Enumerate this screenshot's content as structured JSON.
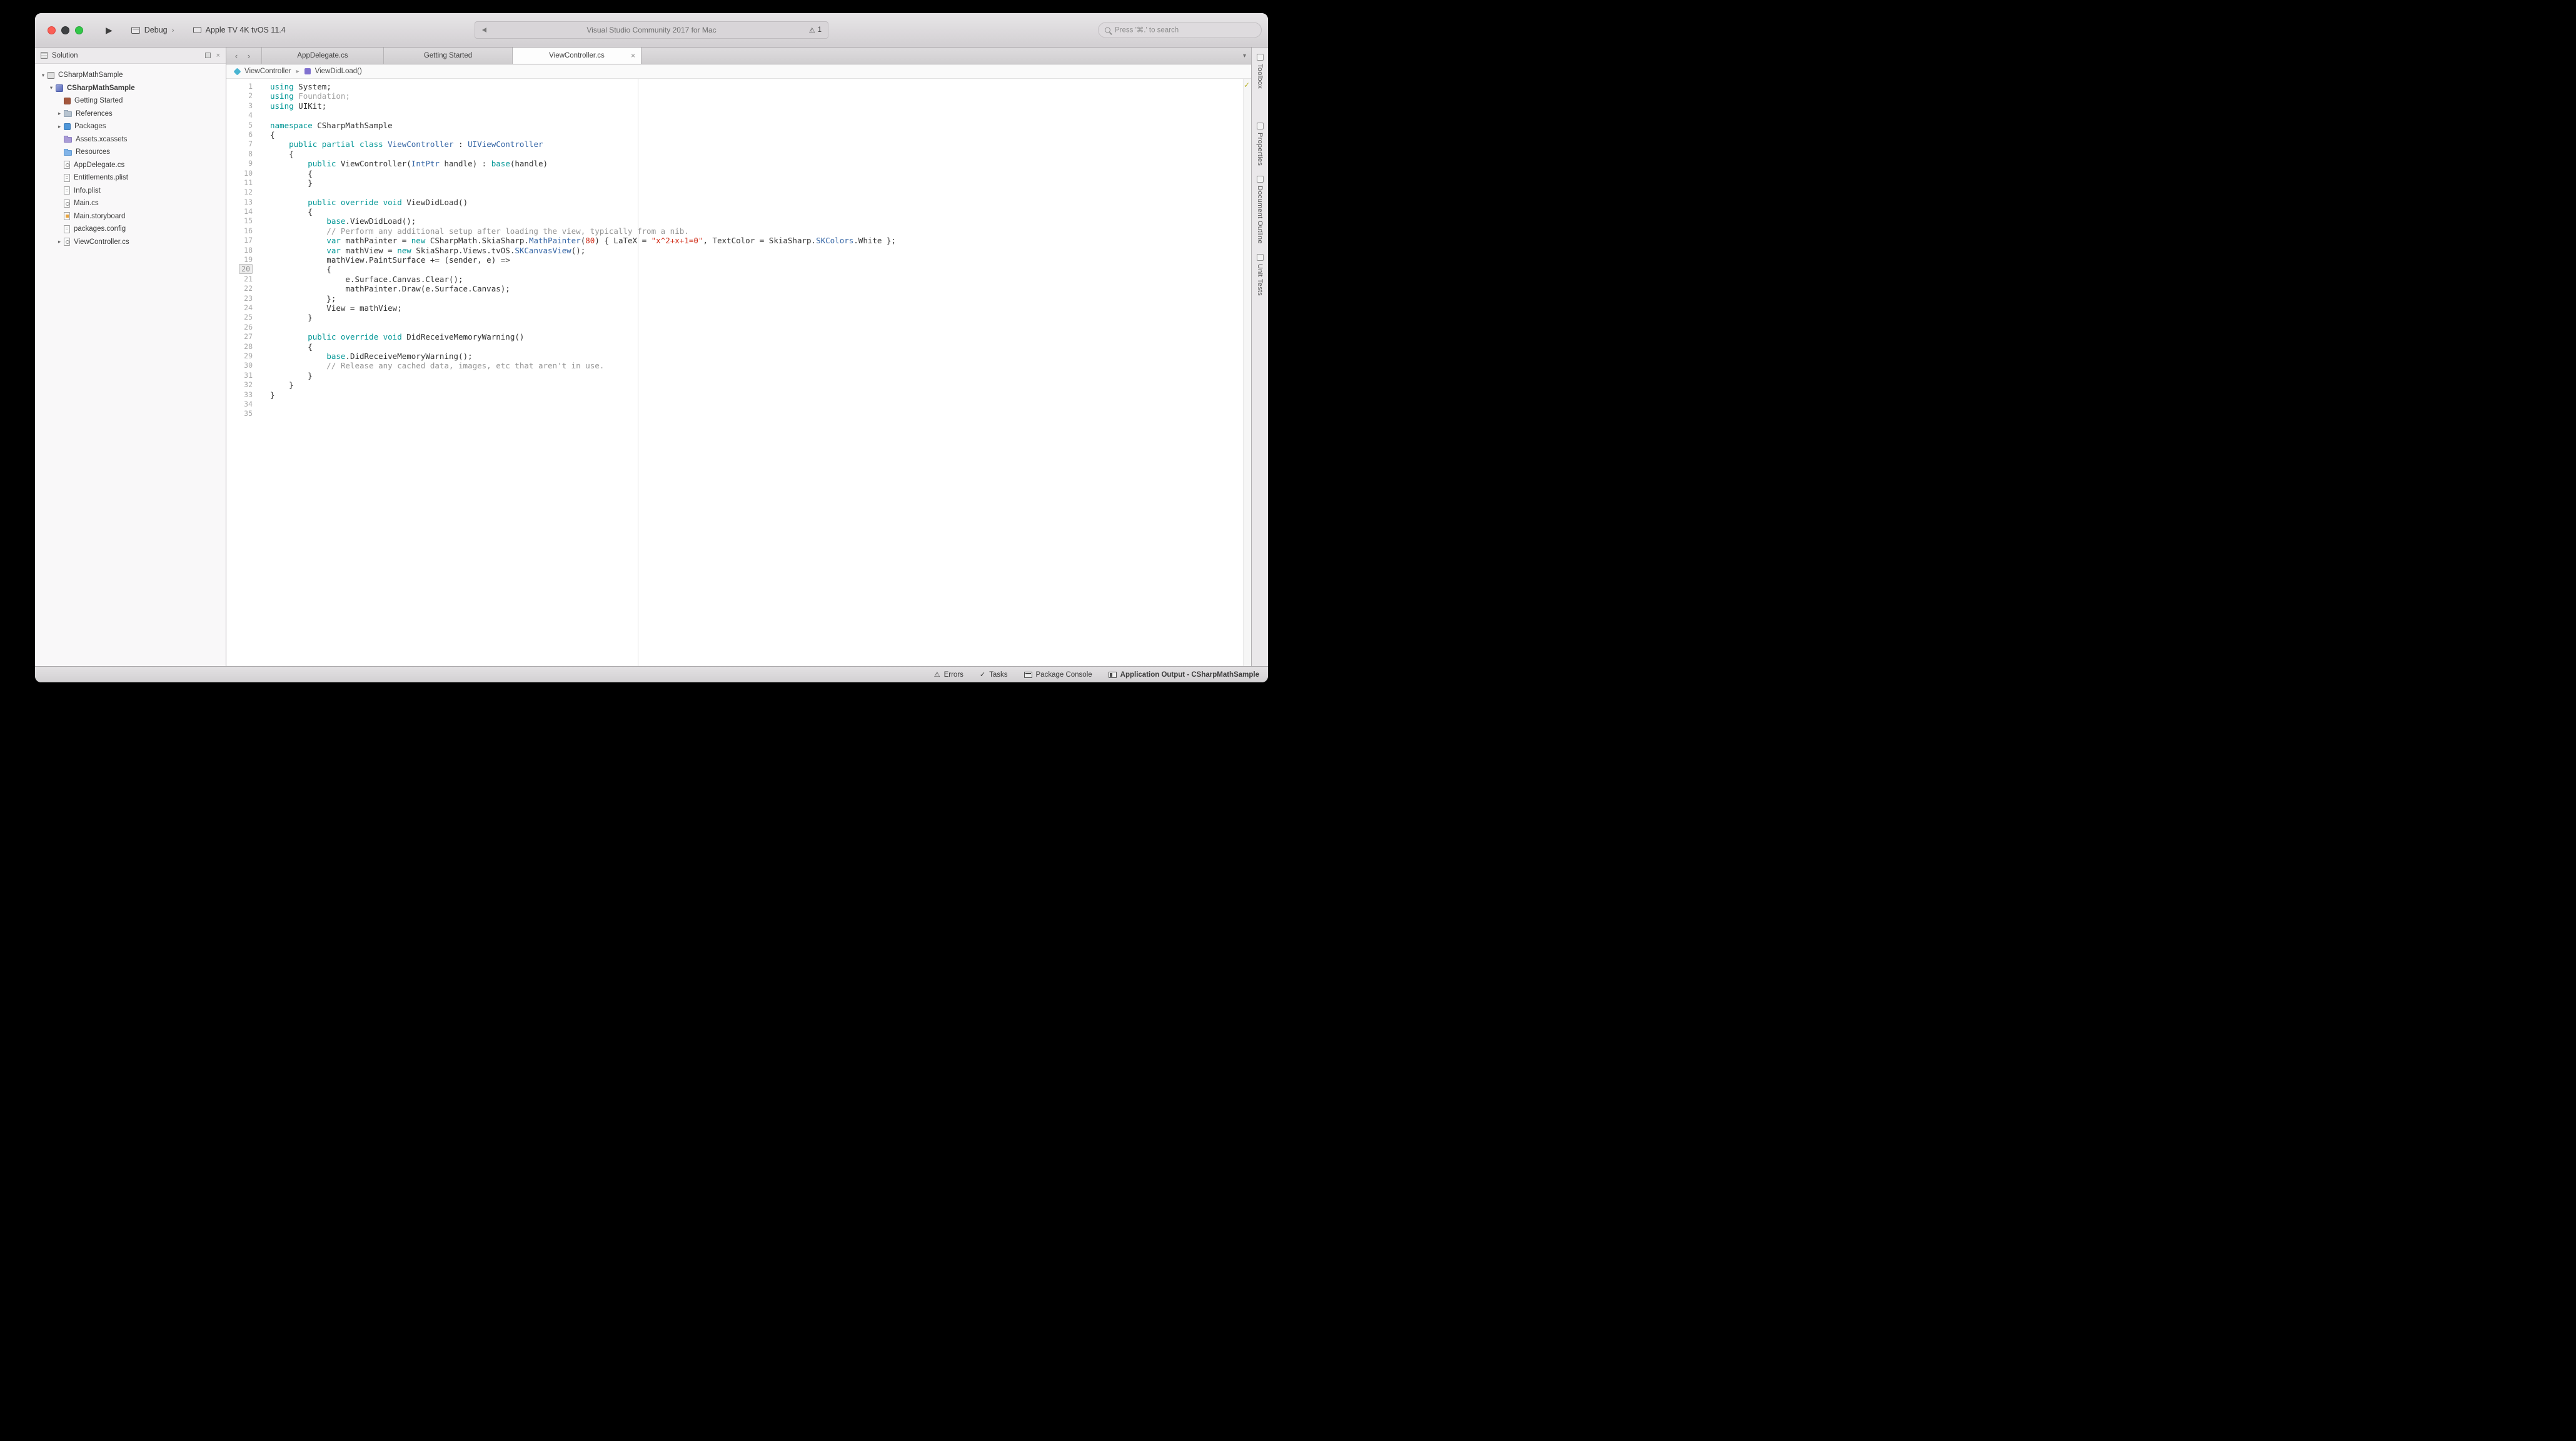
{
  "icons": {
    "run-icon": "▶",
    "back-icon": "‹",
    "forward-icon": "›",
    "overflow-icon": "▾",
    "close-icon": "×",
    "pad-close-icon": "×",
    "disclosure-open-icon": "▾",
    "disclosure-closed-icon": "▸",
    "crumb-separator-icon": "▸",
    "warning-icon": "⚠",
    "errors-icon": "⚠",
    "tasks-icon": "✓",
    "status-check-icon": "✓"
  },
  "colors": {
    "keyword": "#009695",
    "type": "#3364a4",
    "string": "#d12f1b",
    "comment": "#949494",
    "accent_titlebar": "#d8d5d8"
  },
  "window": {
    "toolbar": {
      "debug_label": "Debug",
      "debug_chevron": "›",
      "device_label": "Apple TV 4K tvOS 11.4",
      "status_text": "Visual Studio Community 2017 for Mac",
      "warning_count": "1",
      "search_placeholder": "Press '⌘.' to search"
    }
  },
  "sidebar": {
    "header": "Solution",
    "tree": [
      {
        "label": "CSharpMathSample",
        "level": 0,
        "disclosure": "open",
        "icon": "solution-icon",
        "bold": false
      },
      {
        "label": "CSharpMathSample",
        "level": 1,
        "disclosure": "open",
        "icon": "project-icon",
        "bold": true
      },
      {
        "label": "Getting Started",
        "level": 2,
        "disclosure": "none",
        "icon": "getting-started-icon",
        "bold": false
      },
      {
        "label": "References",
        "level": 2,
        "disclosure": "closed",
        "icon": "references-icon",
        "bold": false
      },
      {
        "label": "Packages",
        "level": 2,
        "disclosure": "closed",
        "icon": "packages-icon",
        "bold": false
      },
      {
        "label": "Assets.xcassets",
        "level": 2,
        "disclosure": "none",
        "icon": "asset-catalog-icon",
        "bold": false
      },
      {
        "label": "Resources",
        "level": 2,
        "disclosure": "none",
        "icon": "folder-icon",
        "bold": false
      },
      {
        "label": "AppDelegate.cs",
        "level": 2,
        "disclosure": "none",
        "icon": "csharp-file-icon",
        "bold": false
      },
      {
        "label": "Entitlements.plist",
        "level": 2,
        "disclosure": "none",
        "icon": "plist-file-icon",
        "bold": false
      },
      {
        "label": "Info.plist",
        "level": 2,
        "disclosure": "none",
        "icon": "plist-file-icon",
        "bold": false
      },
      {
        "label": "Main.cs",
        "level": 2,
        "disclosure": "none",
        "icon": "csharp-file-icon",
        "bold": false
      },
      {
        "label": "Main.storyboard",
        "level": 2,
        "disclosure": "none",
        "icon": "storyboard-file-icon",
        "bold": false
      },
      {
        "label": "packages.config",
        "level": 2,
        "disclosure": "none",
        "icon": "config-file-icon",
        "bold": false
      },
      {
        "label": "ViewController.cs",
        "level": 2,
        "disclosure": "closed",
        "icon": "csharp-file-icon",
        "bold": false
      }
    ]
  },
  "tabs": {
    "items": [
      {
        "label": "AppDelegate.cs",
        "active": false,
        "closable": false
      },
      {
        "label": "Getting Started",
        "active": false,
        "closable": false
      },
      {
        "label": "ViewController.cs",
        "active": true,
        "closable": true
      }
    ]
  },
  "breadcrumb": {
    "items": [
      {
        "icon": "class-icon",
        "label": "ViewController"
      },
      {
        "icon": "method-icon",
        "label": "ViewDidLoad()"
      }
    ]
  },
  "editor": {
    "current_line": 20,
    "lines": [
      {
        "n": 1,
        "t": [
          [
            "kw",
            "using"
          ],
          [
            "pl",
            " System;"
          ]
        ]
      },
      {
        "n": 2,
        "t": [
          [
            "kw",
            "using"
          ],
          [
            "gr",
            " Foundation;"
          ]
        ]
      },
      {
        "n": 3,
        "t": [
          [
            "kw",
            "using"
          ],
          [
            "pl",
            " UIKit;"
          ]
        ]
      },
      {
        "n": 4,
        "t": []
      },
      {
        "n": 5,
        "t": [
          [
            "kw",
            "namespace"
          ],
          [
            "pl",
            " CSharpMathSample"
          ]
        ]
      },
      {
        "n": 6,
        "t": [
          [
            "pl",
            "{"
          ]
        ]
      },
      {
        "n": 7,
        "t": [
          [
            "pl",
            "    "
          ],
          [
            "kw",
            "public partial class"
          ],
          [
            "pl",
            " "
          ],
          [
            "ty",
            "ViewController"
          ],
          [
            "pl",
            " : "
          ],
          [
            "ty",
            "UIViewController"
          ]
        ]
      },
      {
        "n": 8,
        "t": [
          [
            "pl",
            "    {"
          ]
        ]
      },
      {
        "n": 9,
        "t": [
          [
            "pl",
            "        "
          ],
          [
            "kw",
            "public"
          ],
          [
            "pl",
            " ViewController("
          ],
          [
            "ty",
            "IntPtr"
          ],
          [
            "pl",
            " handle) : "
          ],
          [
            "kw",
            "base"
          ],
          [
            "pl",
            "(handle)"
          ]
        ]
      },
      {
        "n": 10,
        "t": [
          [
            "pl",
            "        {"
          ]
        ]
      },
      {
        "n": 11,
        "t": [
          [
            "pl",
            "        }"
          ]
        ]
      },
      {
        "n": 12,
        "t": []
      },
      {
        "n": 13,
        "t": [
          [
            "pl",
            "        "
          ],
          [
            "kw",
            "public override void"
          ],
          [
            "pl",
            " ViewDidLoad()"
          ]
        ]
      },
      {
        "n": 14,
        "t": [
          [
            "pl",
            "        {"
          ]
        ]
      },
      {
        "n": 15,
        "t": [
          [
            "pl",
            "            "
          ],
          [
            "kw",
            "base"
          ],
          [
            "pl",
            ".ViewDidLoad();"
          ]
        ]
      },
      {
        "n": 16,
        "t": [
          [
            "cm",
            "            // Perform any additional setup after loading the view, typically from a nib."
          ]
        ]
      },
      {
        "n": 17,
        "t": [
          [
            "pl",
            "            "
          ],
          [
            "kw",
            "var"
          ],
          [
            "pl",
            " mathPainter = "
          ],
          [
            "kw",
            "new"
          ],
          [
            "pl",
            " CSharpMath.SkiaSharp."
          ],
          [
            "ty",
            "MathPainter"
          ],
          [
            "pl",
            "("
          ],
          [
            "nm",
            "80"
          ],
          [
            "pl",
            ") { LaTeX = "
          ],
          [
            "st",
            "\"x^2+x+1=0\""
          ],
          [
            "pl",
            ", TextColor = SkiaSharp."
          ],
          [
            "ty",
            "SKColors"
          ],
          [
            "pl",
            ".White };"
          ]
        ]
      },
      {
        "n": 18,
        "t": [
          [
            "pl",
            "            "
          ],
          [
            "kw",
            "var"
          ],
          [
            "pl",
            " mathView = "
          ],
          [
            "kw",
            "new"
          ],
          [
            "pl",
            " SkiaSharp.Views.tvOS."
          ],
          [
            "ty",
            "SKCanvasView"
          ],
          [
            "pl",
            "();"
          ]
        ]
      },
      {
        "n": 19,
        "t": [
          [
            "pl",
            "            mathView.PaintSurface += (sender, e) =>"
          ]
        ]
      },
      {
        "n": 20,
        "t": [
          [
            "pl",
            "            {"
          ]
        ]
      },
      {
        "n": 21,
        "t": [
          [
            "pl",
            "                e.Surface.Canvas.Clear();"
          ]
        ]
      },
      {
        "n": 22,
        "t": [
          [
            "pl",
            "                mathPainter.Draw(e.Surface.Canvas);"
          ]
        ]
      },
      {
        "n": 23,
        "t": [
          [
            "pl",
            "            };"
          ]
        ]
      },
      {
        "n": 24,
        "t": [
          [
            "pl",
            "            View = mathView;"
          ]
        ]
      },
      {
        "n": 25,
        "t": [
          [
            "pl",
            "        }"
          ]
        ]
      },
      {
        "n": 26,
        "t": []
      },
      {
        "n": 27,
        "t": [
          [
            "pl",
            "        "
          ],
          [
            "kw",
            "public override void"
          ],
          [
            "pl",
            " DidReceiveMemoryWarning()"
          ]
        ]
      },
      {
        "n": 28,
        "t": [
          [
            "pl",
            "        {"
          ]
        ]
      },
      {
        "n": 29,
        "t": [
          [
            "pl",
            "            "
          ],
          [
            "kw",
            "base"
          ],
          [
            "pl",
            ".DidReceiveMemoryWarning();"
          ]
        ]
      },
      {
        "n": 30,
        "t": [
          [
            "cm",
            "            // Release any cached data, images, etc that aren't in use."
          ]
        ]
      },
      {
        "n": 31,
        "t": [
          [
            "pl",
            "        }"
          ]
        ]
      },
      {
        "n": 32,
        "t": [
          [
            "pl",
            "    }"
          ]
        ]
      },
      {
        "n": 33,
        "t": [
          [
            "pl",
            "}"
          ]
        ]
      },
      {
        "n": 34,
        "t": []
      },
      {
        "n": 35,
        "t": []
      }
    ]
  },
  "right_panel_tabs": [
    {
      "icon": "toolbox-icon",
      "label": "Toolbox"
    },
    {
      "icon": "properties-icon",
      "label": "Properties"
    },
    {
      "icon": "document-outline-icon",
      "label": "Document Outline"
    },
    {
      "icon": "unit-tests-icon",
      "label": "Unit Tests"
    }
  ],
  "statusbar": {
    "items": [
      {
        "icon": "errors-icon",
        "label": "Errors",
        "bold": false
      },
      {
        "icon": "tasks-icon",
        "label": "Tasks",
        "bold": false
      },
      {
        "icon": "package-console-icon",
        "label": "Package Console",
        "bold": false
      },
      {
        "icon": "application-output-icon",
        "label": "Application Output - CSharpMathSample",
        "bold": true
      }
    ]
  }
}
